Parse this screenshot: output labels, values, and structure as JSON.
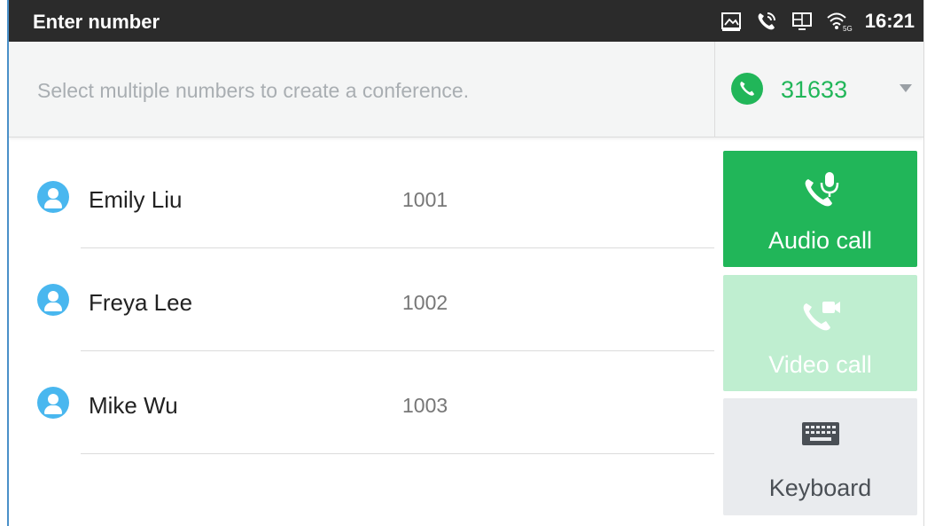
{
  "status_bar": {
    "title": "Enter number",
    "time": "16:21",
    "icons": [
      "screenshot-icon",
      "call-status-icon",
      "monitor-icon",
      "wifi-5g-icon"
    ]
  },
  "hint_bar": {
    "placeholder": "Select multiple numbers to create a conference.",
    "account": {
      "icon": "phone-icon",
      "number": "31633",
      "color": "#21b659"
    }
  },
  "contacts": [
    {
      "name": "Emily Liu",
      "number": "1001"
    },
    {
      "name": "Freya Lee",
      "number": "1002"
    },
    {
      "name": "Mike Wu",
      "number": "1003"
    }
  ],
  "actions": {
    "audio_call": {
      "label": "Audio call",
      "icon": "audio-call-icon",
      "color": "#21b659",
      "enabled": true
    },
    "video_call": {
      "label": "Video call",
      "icon": "video-call-icon",
      "color": "#bfeed0",
      "enabled": false
    },
    "keyboard": {
      "label": "Keyboard",
      "icon": "keyboard-icon",
      "color": "#e9ebee"
    }
  }
}
